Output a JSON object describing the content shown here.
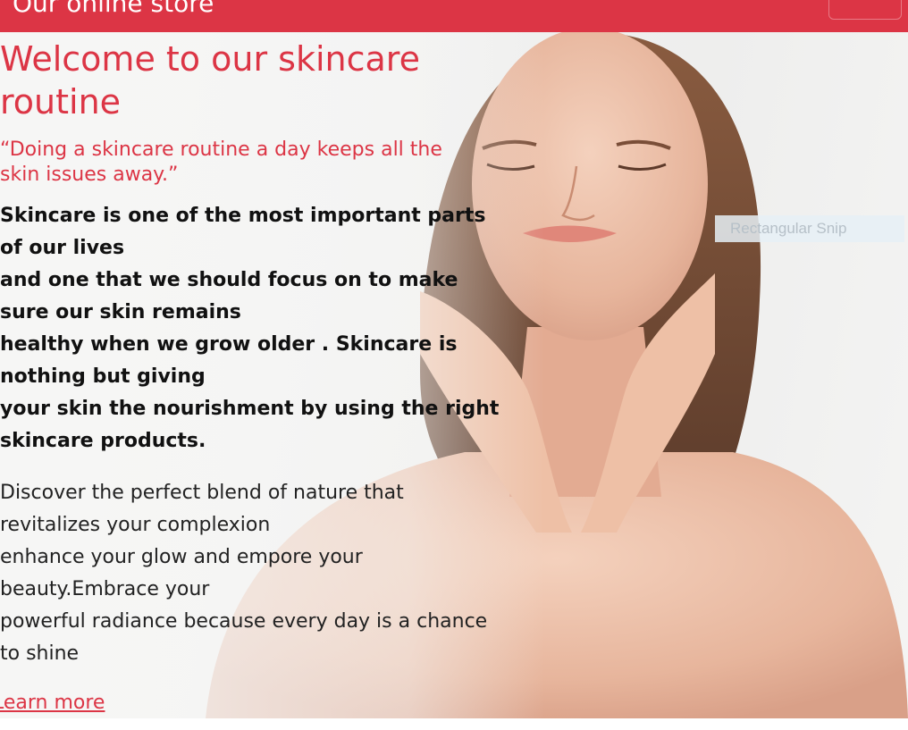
{
  "navbar": {
    "brand": "Our online store",
    "toggler_icon": "hamburger-menu-icon",
    "accent_color": "#dc3545"
  },
  "hero": {
    "title": "Welcome to our skincare routine",
    "quote": "“Doing a skincare routine a day keeps all the skin issues away.”",
    "intro_lines": [
      "Skincare is one of the most important parts",
      "of our lives",
      "and one that we should focus on to make",
      "sure our skin remains",
      "healthy when we grow older . Skincare is",
      "nothing but giving",
      "your skin the nourishment by using the right",
      "skincare products."
    ],
    "discover_lines": [
      "Discover the perfect blend of nature that",
      "revitalizes your complexion",
      "enhance your glow and empore your",
      "beauty.Embrace your",
      "powerful radiance because every day is a chance",
      "to shine"
    ],
    "cta": "Learn more"
  },
  "overlay": {
    "snip_label": "Rectangular Snip"
  }
}
